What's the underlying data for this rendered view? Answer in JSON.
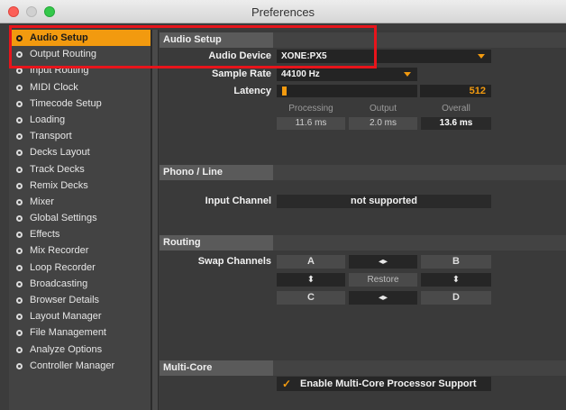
{
  "window": {
    "title": "Preferences"
  },
  "sidebar": {
    "items": [
      {
        "label": "Audio Setup",
        "active": true
      },
      {
        "label": "Output Routing"
      },
      {
        "label": "Input Routing"
      },
      {
        "label": "MIDI Clock"
      },
      {
        "label": "Timecode Setup"
      },
      {
        "label": "Loading"
      },
      {
        "label": "Transport"
      },
      {
        "label": "Decks Layout"
      },
      {
        "label": "Track Decks"
      },
      {
        "label": "Remix Decks"
      },
      {
        "label": "Mixer"
      },
      {
        "label": "Global Settings"
      },
      {
        "label": "Effects"
      },
      {
        "label": "Mix Recorder"
      },
      {
        "label": "Loop Recorder"
      },
      {
        "label": "Broadcasting"
      },
      {
        "label": "Browser Details"
      },
      {
        "label": "Layout Manager"
      },
      {
        "label": "File Management"
      },
      {
        "label": "Analyze Options"
      },
      {
        "label": "Controller Manager"
      }
    ]
  },
  "audio_setup": {
    "heading": "Audio Setup",
    "device_label": "Audio Device",
    "device_value": "XONE:PX5",
    "sample_rate_label": "Sample Rate",
    "sample_rate_value": "44100 Hz",
    "latency_label": "Latency",
    "latency_value": "512",
    "latency_level": 0.02,
    "processing_label": "Processing",
    "output_label": "Output",
    "overall_label": "Overall",
    "processing_value": "11.6 ms",
    "output_value": "2.0 ms",
    "overall_value": "13.6 ms"
  },
  "phono_line": {
    "heading": "Phono / Line",
    "input_channel_label": "Input Channel",
    "input_channel_value": "not supported"
  },
  "routing": {
    "heading": "Routing",
    "swap_label": "Swap Channels",
    "a": "A",
    "b": "B",
    "c": "C",
    "d": "D",
    "swap_lr_glyph": "◂▸",
    "swap_ud_glyph": "⬍",
    "restore": "Restore"
  },
  "multi_core": {
    "heading": "Multi-Core",
    "checkbox_label": "Enable Multi-Core Processor Support",
    "checked": true,
    "check_glyph": "✓"
  },
  "colors": {
    "accent": "#f29a0f",
    "highlight_box": "#e8141b"
  }
}
